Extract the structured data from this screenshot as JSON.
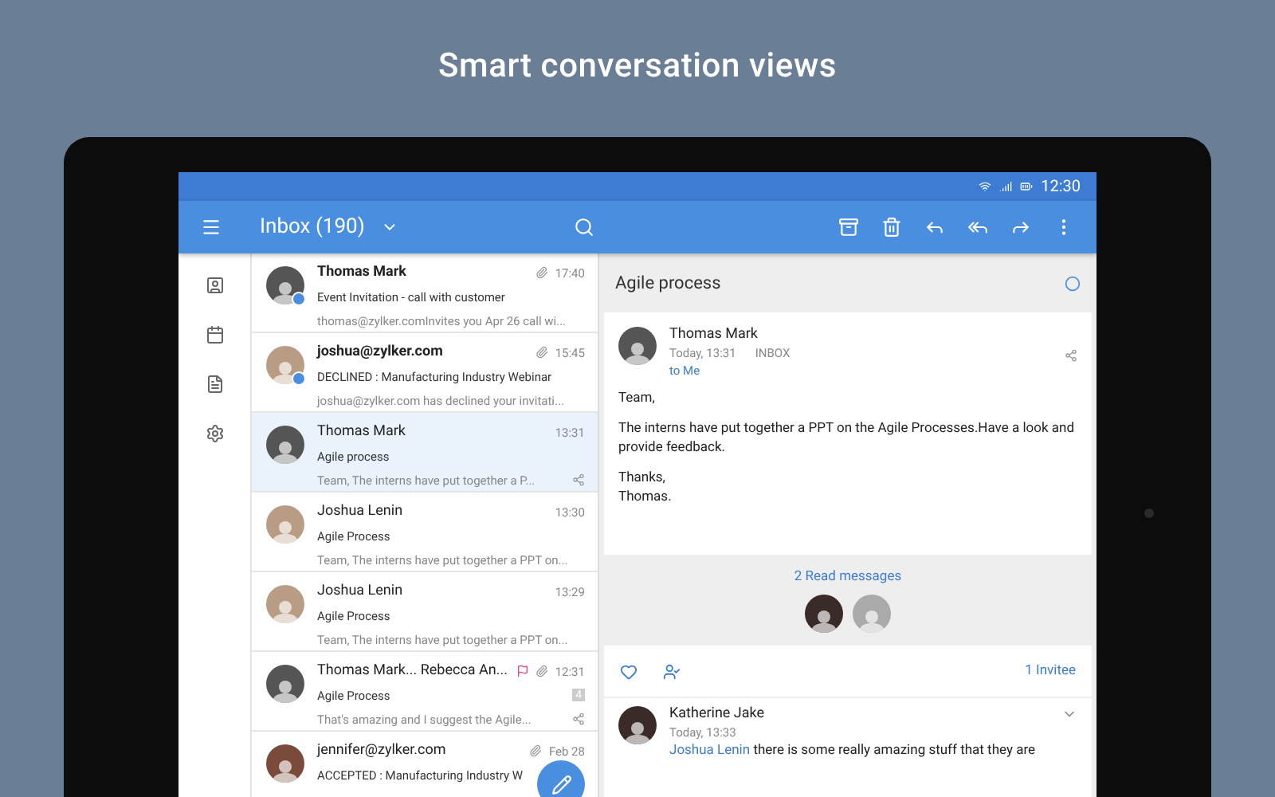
{
  "headline": "Smart conversation views",
  "status_bar": {
    "time": "12:30"
  },
  "toolbar": {
    "folder": "Inbox (190)"
  },
  "emails": [
    {
      "sender": "Thomas Mark",
      "subject": "Event Invitation - call with customer",
      "preview": "thomas@zylker.comInvites you Apr 26 call wi...",
      "time": "17:40",
      "unread": true,
      "attachment": true,
      "flagged": false,
      "selected": false,
      "shared": false
    },
    {
      "sender": "joshua@zylker.com",
      "subject": "DECLINED : Manufacturing Industry Webinar",
      "preview": "joshua@zylker.com has declined your invitati...",
      "time": "15:45",
      "unread": true,
      "attachment": true,
      "flagged": false,
      "selected": false,
      "shared": false
    },
    {
      "sender": "Thomas Mark",
      "subject": "Agile process",
      "preview": "Team, The interns have put together a P...",
      "time": "13:31",
      "unread": false,
      "attachment": false,
      "flagged": false,
      "selected": true,
      "shared": true
    },
    {
      "sender": "Joshua Lenin",
      "subject": "Agile Process",
      "preview": "Team, The interns have put together a PPT on...",
      "time": "13:30",
      "unread": false,
      "attachment": false,
      "flagged": false,
      "selected": false,
      "shared": false
    },
    {
      "sender": "Joshua Lenin",
      "subject": "Agile Process",
      "preview": "Team, The interns have put together a PPT on...",
      "time": "13:29",
      "unread": false,
      "attachment": false,
      "flagged": false,
      "selected": false,
      "shared": false
    },
    {
      "sender": "Thomas Mark... Rebecca An...",
      "subject": "Agile Process",
      "preview": "That's amazing and I suggest the Agile...",
      "time": "12:31",
      "unread": false,
      "attachment": true,
      "flagged": true,
      "selected": false,
      "shared": true,
      "count": "4"
    },
    {
      "sender": "jennifer@zylker.com",
      "subject": "ACCEPTED : Manufacturing Industry W",
      "time": "Feb 28",
      "unread": false,
      "attachment": true,
      "flagged": false,
      "selected": false
    }
  ],
  "detail": {
    "subject": "Agile process",
    "from": "Thomas Mark",
    "date": "Today, 13:31",
    "folder": "INBOX",
    "to": "to Me",
    "body": [
      "Team,",
      "The interns have put together a PPT on the Agile Processes.Have a look and provide feedback.",
      "Thanks,\nThomas."
    ],
    "read_messages": "2 Read messages",
    "invitees": "1 Invitee",
    "reply": {
      "sender": "Katherine Jake",
      "date": "Today, 13:33",
      "mention": "Joshua Lenin",
      "text": "there is some really amazing stuff that they are"
    }
  }
}
